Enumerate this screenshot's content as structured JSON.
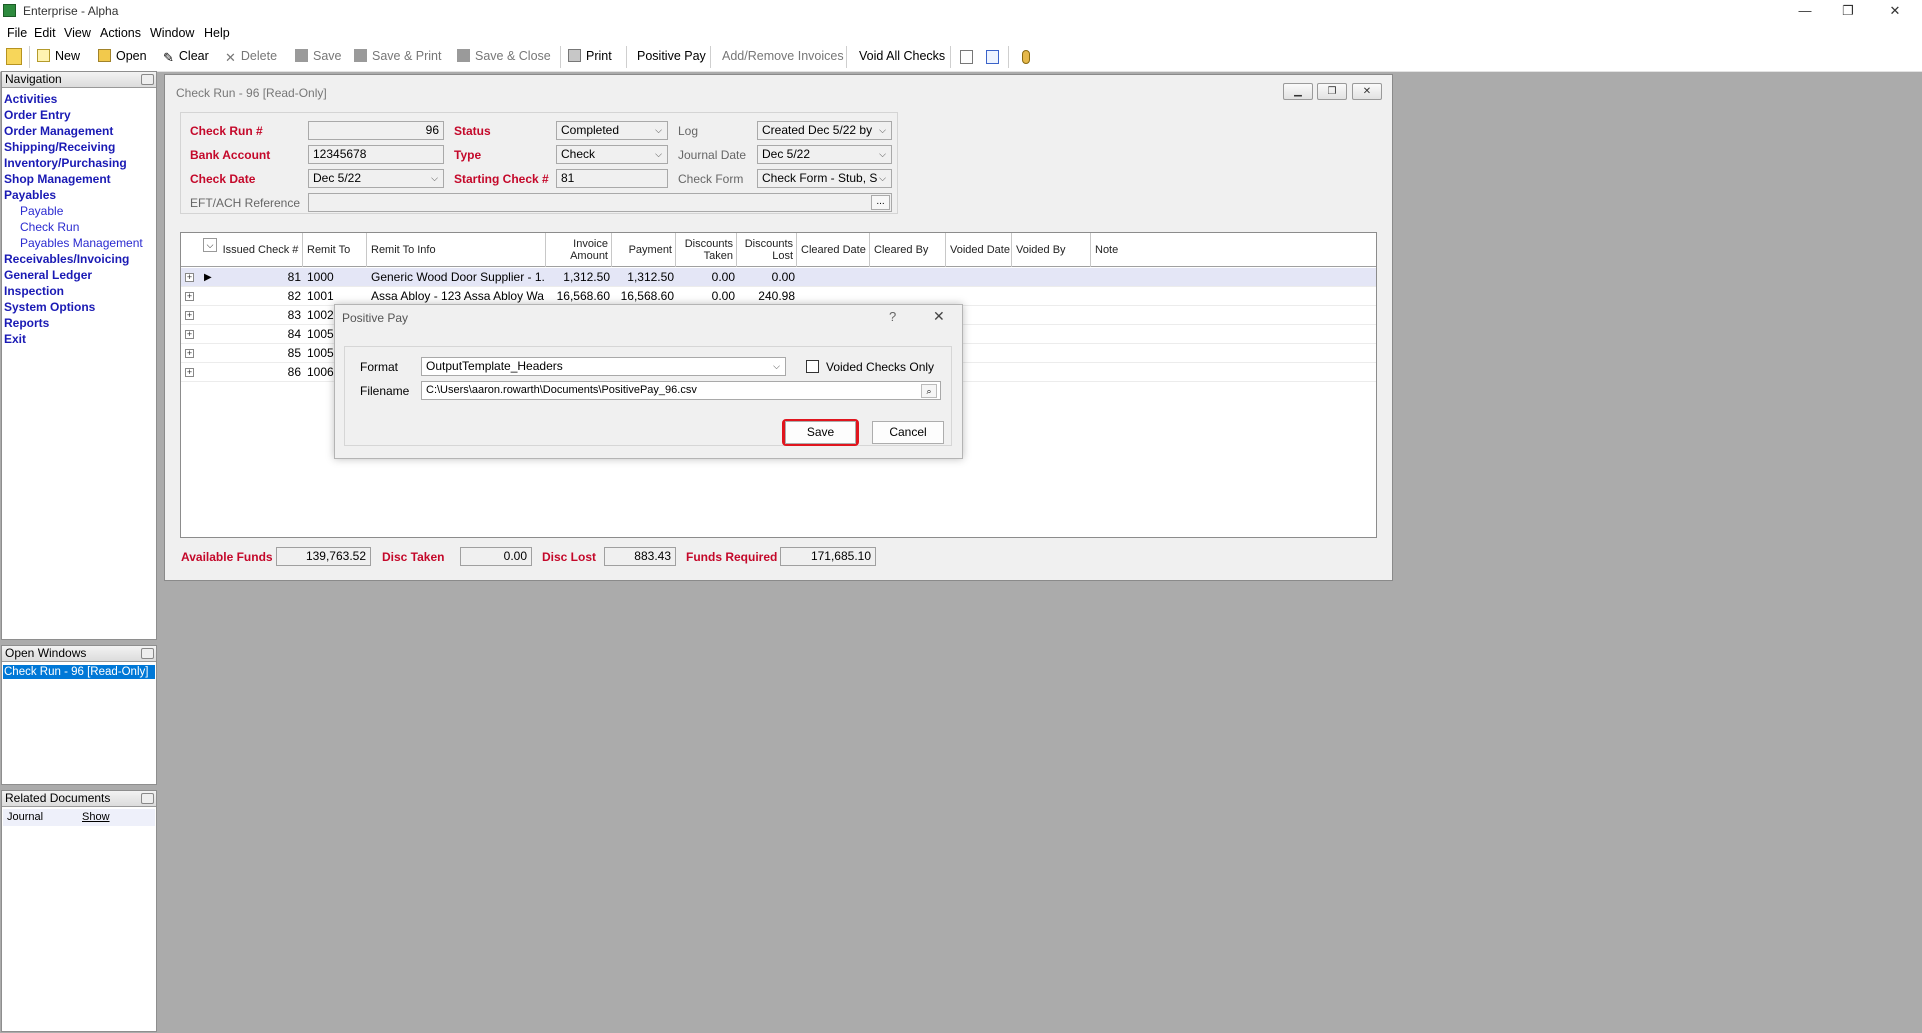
{
  "app": {
    "title": "Enterprise - Alpha",
    "window_controls": {
      "minimize": "—",
      "restore": "❐",
      "close": "✕"
    }
  },
  "menu": [
    "File",
    "Edit",
    "View",
    "Actions",
    "Window",
    "Help"
  ],
  "toolbar": {
    "new": "New",
    "open": "Open",
    "clear": "Clear",
    "delete": "Delete",
    "save": "Save",
    "save_print": "Save & Print",
    "save_close": "Save & Close",
    "print": "Print",
    "positive_pay": "Positive Pay",
    "add_remove_invoices": "Add/Remove Invoices",
    "void_all_checks": "Void All Checks"
  },
  "navigation": {
    "title": "Navigation",
    "items": [
      "Activities",
      "Order Entry",
      "Order Management",
      "Shipping/Receiving",
      "Inventory/Purchasing",
      "Shop Management",
      "Payables"
    ],
    "payables_sub": [
      "Payable",
      "Check Run",
      "Payables Management"
    ],
    "items_after": [
      "Receivables/Invoicing",
      "General Ledger",
      "Inspection",
      "System Options",
      "Reports",
      "Exit"
    ]
  },
  "open_windows": {
    "title": "Open Windows",
    "items": [
      "Check Run - 96 [Read-Only]"
    ]
  },
  "related_documents": {
    "title": "Related Documents",
    "row": {
      "name": "Journal",
      "action": "Show"
    }
  },
  "check_run": {
    "window_title": "Check Run - 96 [Read-Only]",
    "labels": {
      "check_run_no": "Check Run #",
      "bank_account": "Bank Account",
      "check_date": "Check Date",
      "eft_ref": "EFT/ACH Reference",
      "status": "Status",
      "type": "Type",
      "starting_check": "Starting Check #",
      "log": "Log",
      "journal_date": "Journal Date",
      "check_form": "Check Form"
    },
    "values": {
      "check_run_no": "96",
      "bank_account": "12345678",
      "check_date": "Dec 5/22",
      "eft_ref": "",
      "eft_ref_button": "...",
      "status": "Completed",
      "type": "Check",
      "starting_check": "81",
      "log": "Created Dec 5/22 by",
      "journal_date": "Dec 5/22",
      "check_form": "Check Form - Stub, S"
    },
    "grid": {
      "columns": [
        "Issued Check #",
        "Remit To",
        "Remit To Info",
        "Invoice Amount",
        "Payment",
        "Discounts Taken",
        "Discounts Lost",
        "Cleared Date",
        "Cleared By",
        "Voided Date",
        "Voided By",
        "Note"
      ],
      "rows": [
        {
          "check": "81",
          "remit_to": "1000",
          "info": "Generic Wood Door Supplier - 1...",
          "invoice": "1,312.50",
          "payment": "1,312.50",
          "disc_taken": "0.00",
          "disc_lost": "0.00"
        },
        {
          "check": "82",
          "remit_to": "1001",
          "info": "Assa Abloy - 123 Assa Abloy Wa...",
          "invoice": "16,568.60",
          "payment": "16,568.60",
          "disc_taken": "0.00",
          "disc_lost": "240.98"
        },
        {
          "check": "83",
          "remit_to": "1002",
          "info": "",
          "invoice": "",
          "payment": "",
          "disc_taken": "",
          "disc_lost": ""
        },
        {
          "check": "84",
          "remit_to": "1005",
          "info": "",
          "invoice": "",
          "payment": "",
          "disc_taken": "",
          "disc_lost": ""
        },
        {
          "check": "85",
          "remit_to": "1005",
          "info": "",
          "invoice": "",
          "payment": "",
          "disc_taken": "",
          "disc_lost": ""
        },
        {
          "check": "86",
          "remit_to": "1006",
          "info": "",
          "invoice": "",
          "payment": "",
          "disc_taken": "",
          "disc_lost": ""
        }
      ]
    },
    "footer": {
      "available_funds_label": "Available Funds",
      "available_funds": "139,763.52",
      "disc_taken_label": "Disc Taken",
      "disc_taken": "0.00",
      "disc_lost_label": "Disc Lost",
      "disc_lost": "883.43",
      "funds_required_label": "Funds Required",
      "funds_required": "171,685.10"
    }
  },
  "dialog": {
    "title": "Positive Pay",
    "help": "?",
    "close": "✕",
    "format_label": "Format",
    "format_value": "OutputTemplate_Headers",
    "voided_only_label": "Voided Checks Only",
    "filename_label": "Filename",
    "filename_value": "C:\\Users\\aaron.rowarth\\Documents\\PositivePay_96.csv",
    "save": "Save",
    "cancel": "Cancel"
  },
  "colors": {
    "required_label": "#c4082a",
    "nav_link": "#1a1ab4",
    "highlight_outline": "#e0151e",
    "selection": "#0078d7"
  }
}
